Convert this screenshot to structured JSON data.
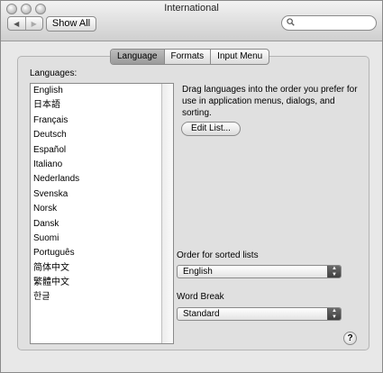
{
  "window": {
    "title": "International"
  },
  "toolbar": {
    "back_icon": "back-arrow-icon",
    "forward_icon": "forward-arrow-icon",
    "back_glyph": "◀",
    "forward_glyph": "▶",
    "show_all_label": "Show All",
    "search": {
      "placeholder": "",
      "value": ""
    }
  },
  "tabs": [
    {
      "label": "Language",
      "selected": true
    },
    {
      "label": "Formats",
      "selected": false
    },
    {
      "label": "Input Menu",
      "selected": false
    }
  ],
  "languages": {
    "label": "Languages:",
    "items": [
      "English",
      "日本語",
      "Français",
      "Deutsch",
      "Español",
      "Italiano",
      "Nederlands",
      "Svenska",
      "Norsk",
      "Dansk",
      "Suomi",
      "Português",
      "简体中文",
      "繁體中文",
      "한글"
    ]
  },
  "instructions": "Drag languages into the order you prefer for use in application menus, dialogs, and sorting.",
  "edit_list_label": "Edit List...",
  "sort_order": {
    "label": "Order for sorted lists",
    "value": "English"
  },
  "word_break": {
    "label": "Word Break",
    "value": "Standard"
  },
  "help_label": "?"
}
